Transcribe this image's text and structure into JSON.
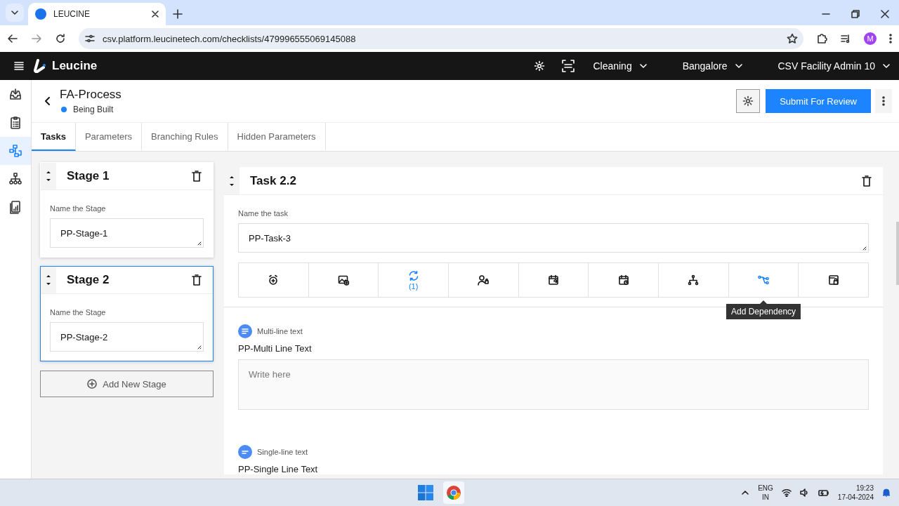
{
  "browser": {
    "tab_title": "LEUCINE",
    "url": "csv.platform.leucinetech.com/checklists/479996555069145088",
    "profile_initial": "M"
  },
  "header": {
    "brand": "Leucine",
    "menus": [
      {
        "label": "Cleaning"
      },
      {
        "label": "Bangalore"
      },
      {
        "label": "CSV Facility Admin 10"
      }
    ]
  },
  "sidebar": {
    "items": [
      {
        "kind": "inbox",
        "selected": false
      },
      {
        "kind": "checklist",
        "selected": false
      },
      {
        "kind": "process",
        "selected": true
      },
      {
        "kind": "hierarchy",
        "selected": false
      },
      {
        "kind": "reports",
        "selected": false
      }
    ]
  },
  "checklist": {
    "title": "FA-Process",
    "status": "Being Built",
    "submit_button": "Submit For Review"
  },
  "tabs": [
    {
      "label": "Tasks",
      "selected": true
    },
    {
      "label": "Parameters",
      "selected": false
    },
    {
      "label": "Branching Rules",
      "selected": false
    },
    {
      "label": "Hidden Parameters",
      "selected": false
    }
  ],
  "stages": [
    {
      "title": "Stage 1",
      "field_label": "Name the Stage",
      "value": "PP-Stage-1",
      "selected": false
    },
    {
      "title": "Stage 2",
      "field_label": "Name the Stage",
      "value": "PP-Stage-2",
      "selected": true
    }
  ],
  "add_stage_button": "Add New Stage",
  "task": {
    "title": "Task 2.2",
    "field_label": "Name the task",
    "value": "PP-Task-3",
    "actions": [
      {
        "kind": "timer",
        "active": false
      },
      {
        "kind": "media",
        "active": false
      },
      {
        "kind": "recurrence",
        "active": true,
        "count": "(1)"
      },
      {
        "kind": "assignee",
        "active": false
      },
      {
        "kind": "schedule",
        "active": false
      },
      {
        "kind": "due",
        "active": false
      },
      {
        "kind": "branch",
        "active": false
      },
      {
        "kind": "dependency",
        "active": true,
        "tooltip": "Add Dependency"
      },
      {
        "kind": "lock",
        "active": false
      }
    ],
    "parameters": [
      {
        "kind": "multi-line",
        "type_label": "Multi-line text",
        "label": "PP-Multi Line Text",
        "placeholder": "Write here"
      },
      {
        "kind": "single-line",
        "type_label": "Single-line text",
        "label": "PP-Single Line Text"
      }
    ]
  },
  "taskbar": {
    "language": "ENG",
    "region": "IN",
    "time": "19:23",
    "date": "17-04-2024"
  }
}
